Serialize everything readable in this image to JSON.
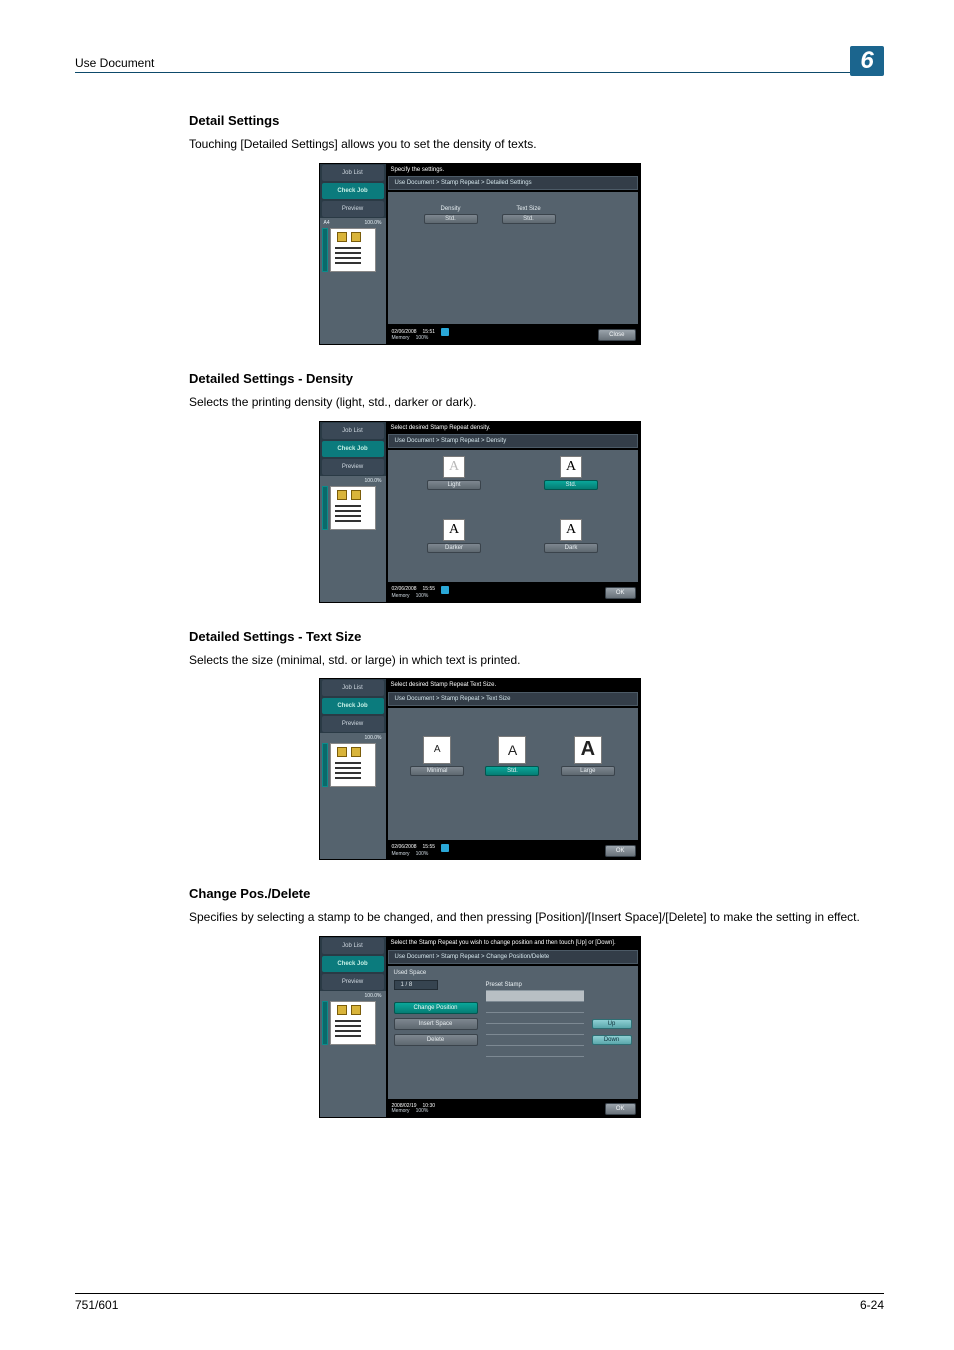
{
  "header": {
    "breadcrumb": "Use Document",
    "chapter_number": "6"
  },
  "sidebar": {
    "job_list": "Job List",
    "check_job": "Check Job",
    "preview": "Preview",
    "paper": "A4",
    "ratio": "100.0%"
  },
  "common_footer": {
    "date1": "02/06/2008",
    "time1": "15:51",
    "date2": "02/06/2008",
    "time2": "15:55",
    "date3": "02/06/2008",
    "time3": "15:55",
    "date4": "2008/02/19",
    "time4": "10:30",
    "memory": "Memory",
    "mem_pct": "100%",
    "close": "Close",
    "ok": "OK"
  },
  "sections": {
    "s1": {
      "title": "Detail Settings",
      "text": "Touching [Detailed Settings] allows you to set the density of texts.",
      "instr": "Specify the settings.",
      "crumb": "Use Document > Stamp Repeat > Detailed Settings",
      "density_label": "Density",
      "density_value": "Std.",
      "textsize_label": "Text Size",
      "textsize_value": "Std."
    },
    "s2": {
      "title": "Detailed Settings - Density",
      "text": "Selects the printing density (light, std., darker or dark).",
      "instr": "Select desired Stamp Repeat density.",
      "crumb": "Use Document > Stamp Repeat > Density",
      "opts": {
        "light": "Light",
        "std": "Std.",
        "darker": "Darker",
        "dark": "Dark"
      }
    },
    "s3": {
      "title": "Detailed Settings - Text Size",
      "text": "Selects the size (minimal, std. or large) in which text is printed.",
      "instr": "Select desired Stamp Repeat Text Size.",
      "crumb": "Use Document > Stamp Repeat > Text Size",
      "opts": {
        "minimal": "Minimal",
        "std": "Std.",
        "large": "Large"
      }
    },
    "s4": {
      "title": "Change Pos./Delete",
      "text": "Specifies by selecting a stamp to be changed, and then pressing [Position]/[Insert Space]/[Delete] to make the setting in effect.",
      "instr": "Select the Stamp Repeat you wish to change position and then touch [Up] or [Down].",
      "crumb": "Use Document > Stamp Repeat > Change Position/Delete",
      "used_space": "Used Space",
      "count": "1  /  8",
      "change_position": "Change Position",
      "insert_space": "Insert Space",
      "delete": "Delete",
      "preset_stamp": "Preset Stamp",
      "up": "Up",
      "down": "Down"
    }
  },
  "footer": {
    "left": "751/601",
    "right": "6-24"
  }
}
